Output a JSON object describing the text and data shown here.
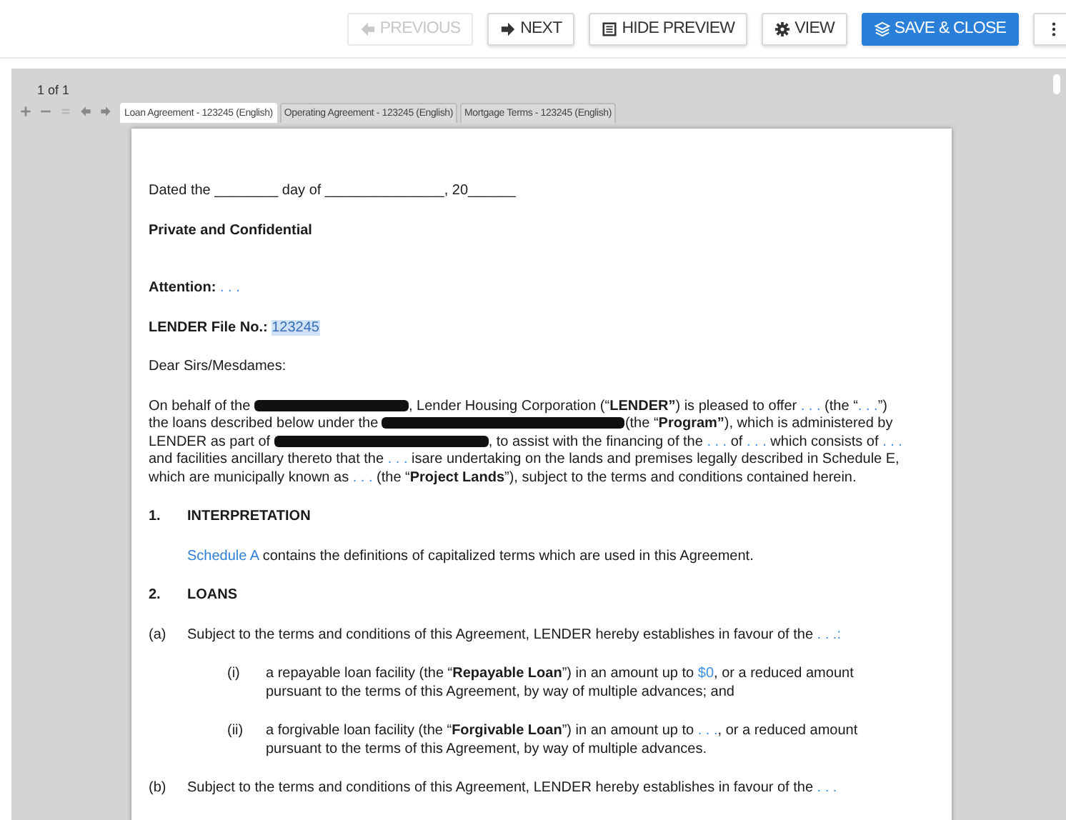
{
  "toolbar": {
    "buttons": [
      {
        "label": "PREVIOUS",
        "kind": "default",
        "disabled": true
      },
      {
        "label": "NEXT",
        "kind": "default",
        "disabled": false
      },
      {
        "label": "HIDE PREVIEW",
        "kind": "default",
        "disabled": false
      },
      {
        "label": "VIEW",
        "kind": "default",
        "disabled": false
      },
      {
        "label": "SAVE & CLOSE",
        "kind": "primary",
        "disabled": false
      },
      {
        "kind": "default",
        "disabled": false
      }
    ]
  },
  "viewer": {
    "page_count": "1 of 1",
    "tools": [
      {
        "disabled": false
      },
      {
        "disabled": false
      },
      {
        "disabled": true
      },
      {
        "disabled": false
      },
      {
        "disabled": false
      }
    ],
    "tabs": [
      {
        "label": "Loan Agreement - 123245 (English)",
        "selected": true
      },
      {
        "label": "Operating Agreement - 123245 (English)",
        "selected": false
      },
      {
        "label": "Mortgage Terms - 123245 (English)",
        "selected": false
      }
    ]
  },
  "document": {
    "blocks": [
      {
        "kind": "para",
        "segments": [
          {
            "kind": "text",
            "text": "Dated the ________ day of _______________, 20______"
          }
        ]
      },
      {
        "kind": "para",
        "segments": [
          {
            "kind": "bold",
            "text": "Private and Confidential"
          }
        ]
      },
      {
        "kind": "para",
        "segments": [
          {
            "kind": "bold",
            "text": "Attention: "
          },
          {
            "kind": "field",
            "text": ". . ."
          }
        ]
      },
      {
        "kind": "para",
        "segments": [
          {
            "kind": "bold",
            "text": "LENDER File No.: "
          },
          {
            "kind": "highlight",
            "text": "123245"
          }
        ]
      },
      {
        "kind": "para",
        "segments": [
          {
            "kind": "text",
            "text": "Dear Sirs/Mesdames:"
          }
        ]
      },
      {
        "kind": "para",
        "segments": [
          {
            "kind": "text",
            "text": "On behalf of the "
          },
          {
            "kind": "redaction"
          },
          {
            "kind": "text",
            "text": ", Lender Housing Corporation (“"
          },
          {
            "kind": "bold",
            "text": "LENDER”"
          },
          {
            "kind": "text",
            "text": ") is pleased to offer "
          },
          {
            "kind": "field",
            "text": ". . ."
          },
          {
            "kind": "text",
            "text": " (the “"
          },
          {
            "kind": "field",
            "text": ". . ."
          },
          {
            "kind": "text",
            "text": "”) the loans described below under the "
          },
          {
            "kind": "redaction"
          },
          {
            "kind": "text",
            "text": "(the “"
          },
          {
            "kind": "bold",
            "text": "Program”"
          },
          {
            "kind": "text",
            "text": "), which is administered by LENDER as part of "
          },
          {
            "kind": "redaction"
          },
          {
            "kind": "text",
            "text": ", to assist with the financing of the "
          },
          {
            "kind": "field",
            "text": ". . ."
          },
          {
            "kind": "text",
            "text": " of "
          },
          {
            "kind": "field",
            "text": ". . ."
          },
          {
            "kind": "text",
            "text": " which consists of "
          },
          {
            "kind": "field",
            "text": ". . ."
          },
          {
            "kind": "text",
            "text": " and facilities ancillary thereto that the "
          },
          {
            "kind": "field",
            "text": ". . ."
          },
          {
            "kind": "text",
            "text": " isare undertaking on the lands and premises legally described in Schedule E, which are municipally known as "
          },
          {
            "kind": "field",
            "text": ". . ."
          },
          {
            "kind": "text",
            "text": " (the “"
          },
          {
            "kind": "bold",
            "text": "Project Lands"
          },
          {
            "kind": "text",
            "text": "”), subject to the terms and conditions contained herein."
          }
        ]
      },
      {
        "kind": "heading",
        "number": "1.",
        "text": "INTERPRETATION"
      },
      {
        "kind": "indent",
        "segments": [
          {
            "kind": "link",
            "text": "Schedule A"
          },
          {
            "kind": "text",
            "text": " contains the definitions of capitalized terms which are used in this Agreement."
          }
        ]
      },
      {
        "kind": "heading",
        "number": "2.",
        "text": "LOANS"
      },
      {
        "kind": "item",
        "number": "(a)",
        "segments": [
          {
            "kind": "text",
            "text": "Subject to the terms and conditions of this Agreement, LENDER hereby establishes in favour of the "
          },
          {
            "kind": "field",
            "text": ". . .:"
          }
        ]
      },
      {
        "kind": "subitem",
        "number": "(i)",
        "segments": [
          {
            "kind": "text",
            "text": "a repayable loan facility (the “"
          },
          {
            "kind": "bold",
            "text": "Repayable Loan"
          },
          {
            "kind": "text",
            "text": "”) in an amount up to "
          },
          {
            "kind": "field",
            "text": "$0"
          },
          {
            "kind": "text",
            "text": ", or a reduced amount pursuant to the terms of this Agreement, by way of multiple advances; and"
          }
        ]
      },
      {
        "kind": "subitem",
        "number": "(ii)",
        "segments": [
          {
            "kind": "text",
            "text": "a forgivable loan facility (the “"
          },
          {
            "kind": "bold",
            "text": "Forgivable Loan"
          },
          {
            "kind": "text",
            "text": "”) in an amount up to "
          },
          {
            "kind": "field",
            "text": ". . ."
          },
          {
            "kind": "text",
            "text": ", or a reduced amount pursuant to the terms of this Agreement, by way of multiple advances."
          }
        ]
      },
      {
        "kind": "item",
        "number": "(b)",
        "segments": [
          {
            "kind": "text",
            "text": "Subject to the terms and conditions of this Agreement, LENDER hereby establishes in favour of the "
          },
          {
            "kind": "field",
            "text": ". . ."
          }
        ]
      }
    ]
  }
}
